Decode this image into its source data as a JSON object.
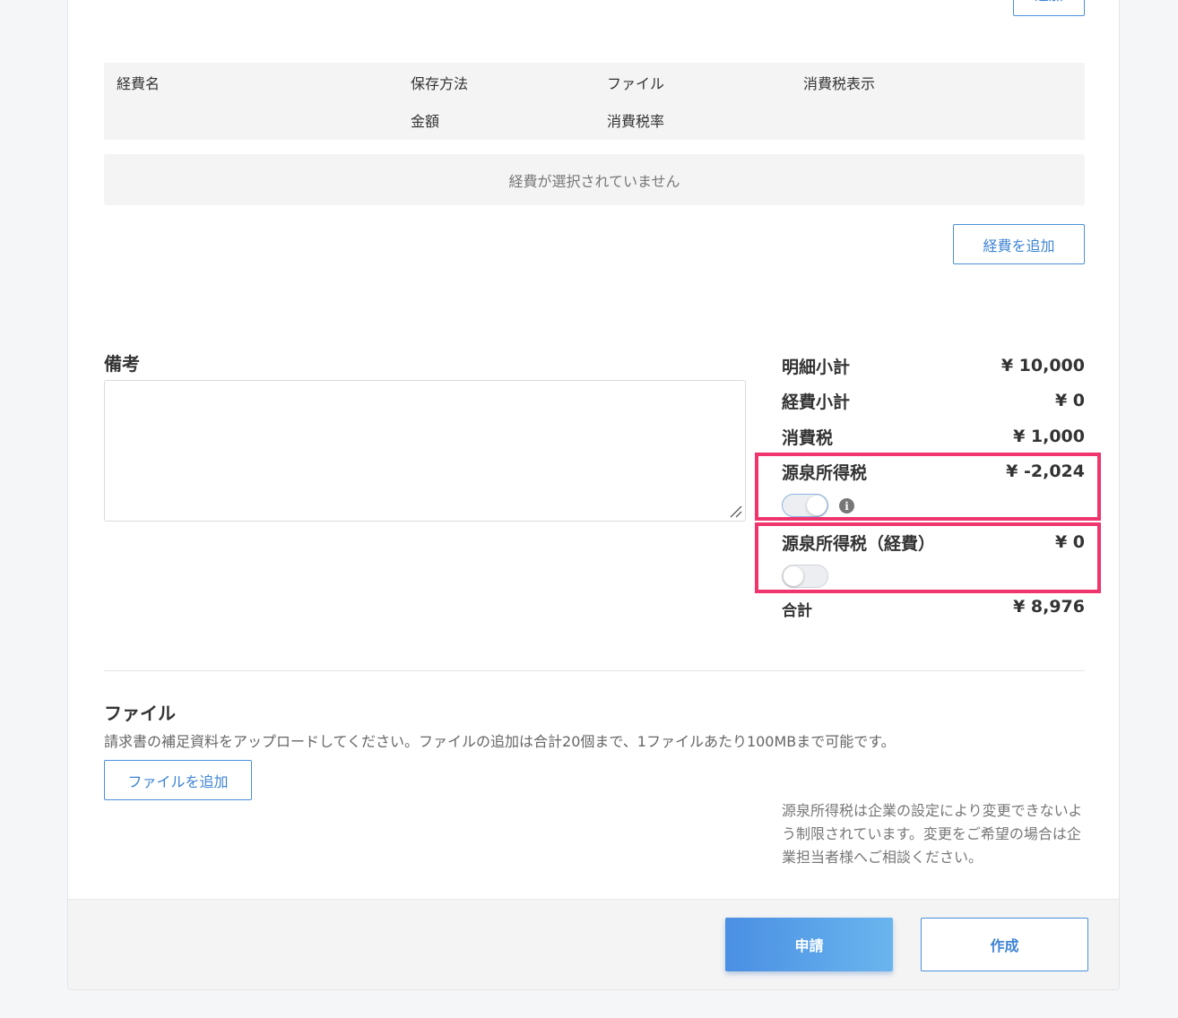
{
  "top_add_button": "追加",
  "expense_table": {
    "headers_row1": [
      "経費名",
      "保存方法",
      "ファイル",
      "消費税表示"
    ],
    "headers_row2": [
      "金額",
      "消費税率"
    ],
    "empty_message": "経費が選択されていません",
    "add_button": "経費を追加"
  },
  "remarks": {
    "label": "備考",
    "value": ""
  },
  "summary": {
    "item_subtotal_label": "明細小計",
    "item_subtotal_value": "¥ 10,000",
    "expense_subtotal_label": "経費小計",
    "expense_subtotal_value": "¥ 0",
    "consumption_tax_label": "消費税",
    "consumption_tax_value": "¥ 1,000",
    "withholding_tax_label": "源泉所得税",
    "withholding_tax_value": "¥ -2,024",
    "withholding_tax_enabled": true,
    "withholding_expense_label": "源泉所得税（経費）",
    "withholding_expense_value": "¥ 0",
    "withholding_expense_enabled": false,
    "total_label": "合計",
    "total_value": "¥ 8,976"
  },
  "files": {
    "title": "ファイル",
    "description": "請求書の補足資料をアップロードしてください。ファイルの追加は合計20個まで、1ファイルあたり100MBまで可能です。",
    "add_button": "ファイルを追加"
  },
  "withholding_note": "源泉所得税は企業の設定により変更できないよう制限されています。変更をご希望の場合は企業担当者様へご相談ください。",
  "footer": {
    "submit_button": "申請",
    "create_button": "作成"
  },
  "colors": {
    "accent": "#4a90d9",
    "highlight": "#f0356e"
  },
  "icons": {
    "info": "info-icon",
    "resize": "resize-grip-icon"
  }
}
